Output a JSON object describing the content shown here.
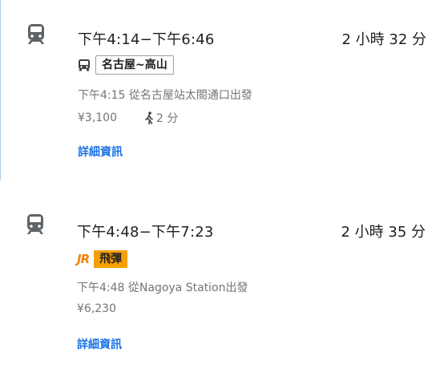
{
  "results": [
    {
      "time_range": "下午4:14−下午6:46",
      "duration": "2 小時 32 分",
      "transit_icon": "bus-icon",
      "line_name": "名古屋~高山",
      "departure": "下午4:15 從名古屋站太閤通口出發",
      "fare": "¥3,100",
      "walk": "2 分",
      "details_label": "詳細資訊"
    },
    {
      "time_range": "下午4:48−下午7:23",
      "duration": "2 小時 35 分",
      "operator_logo": "JR",
      "line_name": "飛彈",
      "line_color": "#f5a000",
      "departure": "下午4:48 從Nagoya Station出發",
      "fare": "¥6,230",
      "details_label": "詳細資訊"
    }
  ]
}
